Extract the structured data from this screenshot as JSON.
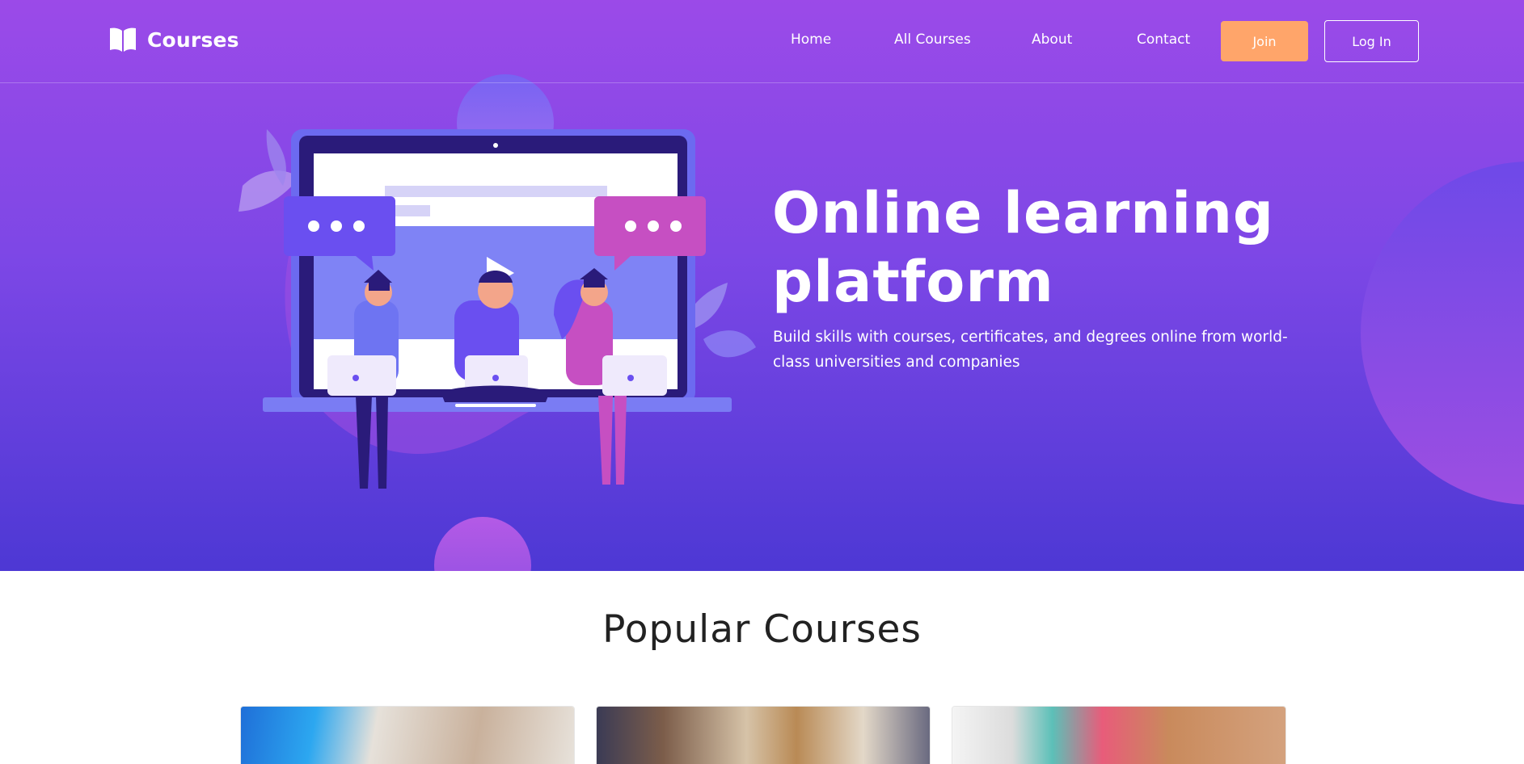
{
  "brand": {
    "title": "Courses",
    "icon": "open-book-icon"
  },
  "nav": {
    "links": [
      "Home",
      "All Courses",
      "About",
      "Contact"
    ],
    "join_label": "Join",
    "login_label": "Log In"
  },
  "hero": {
    "title_line1": "Online learning",
    "title_line2": "platform",
    "subtitle_line1": "Build skills with courses, certificates, and degrees online from world-",
    "subtitle_line2": "class universities and companies"
  },
  "popular": {
    "title": "Popular Courses",
    "cards": [
      "course-photo-1",
      "course-photo-2",
      "course-photo-3"
    ]
  },
  "colors": {
    "hero_top": "#9b4ae8",
    "hero_bottom": "#4d38d4",
    "accent_orange": "#ffa56a",
    "text_white": "#ffffff"
  }
}
